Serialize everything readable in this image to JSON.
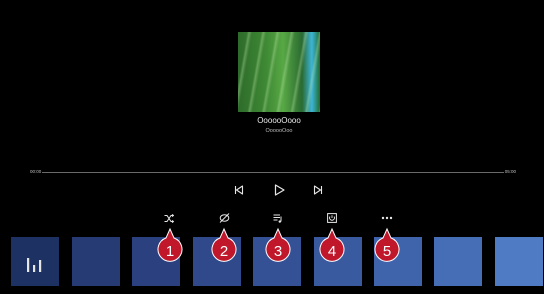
{
  "player": {
    "track_title": "OooooOooo",
    "track_artist": "OooooOoo",
    "elapsed": "00:00",
    "duration": "05:00",
    "progress": 0.0
  },
  "controls": [
    "previous-icon",
    "play-icon",
    "next-icon"
  ],
  "toolbar": [
    "shuffle-icon",
    "no-repeat-icon",
    "queue-icon",
    "screen-icon",
    "more-icon"
  ],
  "callouts": [
    "1",
    "2",
    "3",
    "4",
    "5"
  ],
  "colors": {
    "background": "#000000",
    "callout": "#c0172b",
    "thumb_dark": "#1f3266",
    "thumb_light": "#4f7fc4"
  }
}
